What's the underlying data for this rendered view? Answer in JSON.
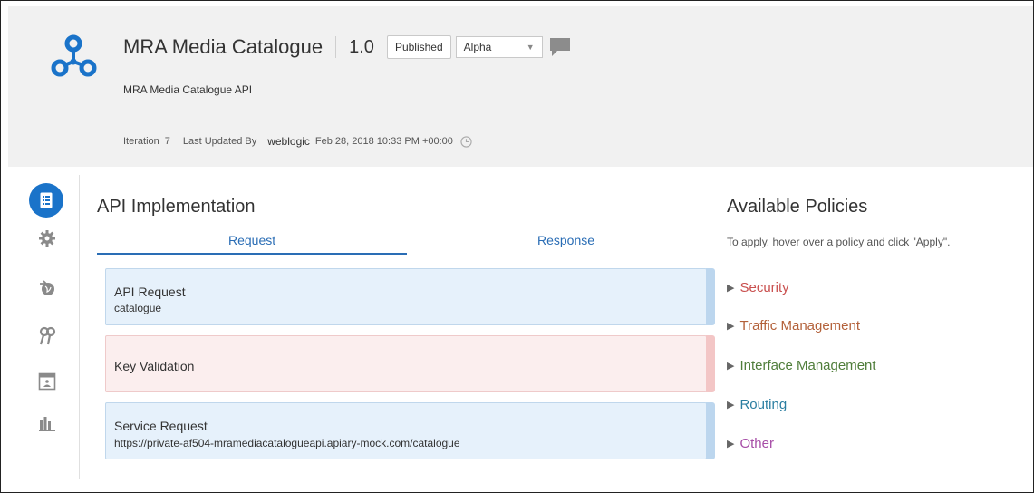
{
  "header": {
    "api_name": "MRA Media Catalogue",
    "version": "1.0",
    "status_button": "Published",
    "stage_select": "Alpha",
    "description": "MRA Media Catalogue API",
    "meta": {
      "iteration_label": "Iteration",
      "iteration_value": "7",
      "last_updated_label": "Last Updated By",
      "user": "weblogic",
      "timestamp": "Feb 28, 2018 10:33 PM +00:00"
    }
  },
  "nav": {
    "items": [
      {
        "name": "implementation",
        "icon": "document-list-icon",
        "active": true
      },
      {
        "name": "settings",
        "icon": "gear-icon"
      },
      {
        "name": "deployments",
        "icon": "globe-arrow-icon"
      },
      {
        "name": "grants",
        "icon": "keys-icon"
      },
      {
        "name": "registrations",
        "icon": "portal-icon"
      },
      {
        "name": "analytics",
        "icon": "bar-chart-icon"
      }
    ]
  },
  "main": {
    "title": "API Implementation",
    "tabs": [
      "Request",
      "Response"
    ],
    "active_tab": "Request",
    "cards": [
      {
        "title": "API Request",
        "subtitle": "catalogue"
      },
      {
        "title": "Key Validation",
        "subtitle": ""
      },
      {
        "title": "Service Request",
        "subtitle": "https://private-af504-mramediacatalogueapi.apiary-mock.com/catalogue"
      }
    ]
  },
  "policies": {
    "title": "Available Policies",
    "help": "To apply, hover over a policy and click \"Apply\".",
    "items": [
      {
        "label": "Security",
        "color": "#c9504f"
      },
      {
        "label": "Traffic Management",
        "color": "#b3613a"
      },
      {
        "label": "Interface Management",
        "color": "#4f7d3a"
      },
      {
        "label": "Routing",
        "color": "#2b7ea1"
      },
      {
        "label": "Other",
        "color": "#a64ca6"
      }
    ]
  },
  "colors": {
    "accent": "#2a6db5",
    "logo": "#1a73c9",
    "header_bg": "#f1f1f1"
  }
}
